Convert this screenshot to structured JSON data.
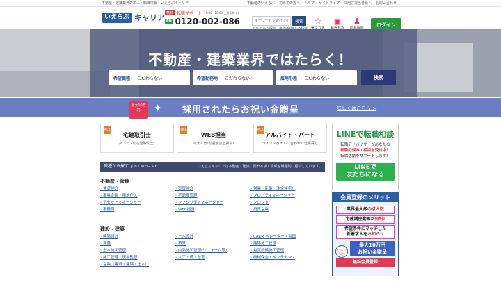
{
  "topbar": {
    "tagline": "不動産・建築業界の求人・転職情報｜いえらぶキャリア",
    "links": [
      "不動産のいえらぶ",
      "初めての方へ",
      "ヘルプ",
      "サイトマップ",
      "採用ご担当者様へ",
      "お問い合わせ"
    ]
  },
  "header": {
    "logo_box": "いえらぶ",
    "logo_text": "キャリア",
    "support_label": "転職サポート",
    "support_hours": "10:00〜18:00(土日祝除く)",
    "support_badge": "無料",
    "freedial": "FD",
    "tel": "0120-002-086",
    "search_placeholder": "キーワードや会社で検索",
    "search_btn": "検索",
    "link_area": "エリアから探す",
    "link_cond": "条件/特徴から探す",
    "fav": "気になる",
    "recent": "最近見た求人",
    "apply": "応募履歴",
    "login": "ログイン"
  },
  "hero": {
    "title": "不動産・建築業界ではたらく！",
    "sel1_key": "希望職種",
    "sel1_val": "こだわらない",
    "sel2_key": "希望勤務地",
    "sel2_val": "こだわらない",
    "sel3_key": "雇用形態",
    "sel3_val": "こだわらない",
    "search": "検索"
  },
  "banner": {
    "tag": "最大10万円",
    "text": "採用されたらお祝い金贈呈",
    "link": "詳しくはこちら >"
  },
  "cards": [
    {
      "pick": "PICK",
      "title": "宅建取引士",
      "desc": "高ニーズの宅建取引士!"
    },
    {
      "pick": "PICK",
      "title": "WEB担当",
      "desc": "今大人気!影響度急上昇中!"
    },
    {
      "pick": "PICK",
      "title": "アルバイト・パート",
      "desc": "ライフスタイルに合わせた仕事探し"
    }
  ],
  "jobs": {
    "head": "職種から探す",
    "head_en": "JOB CATEGORY",
    "note": "いえらぶキャリアは不動産・建築に関わる求人情報を職種別に紹介しています。",
    "cat1": "不動産・管理",
    "cat1_items": [
      "賃貸仲介",
      "売買仲介",
      "営業（新築・注文住宅）",
      "事業企画・用地仕入",
      "不動産管理",
      "プロパティマネージャー",
      "アセットマネージャー",
      "ファシリティマネージャー",
      "フロント",
      "事務職",
      "WEB担当",
      "投資営業"
    ],
    "cat2": "建設・建築",
    "cat2_items": [
      "建築設計",
      "土木設計",
      "CADオペレーター・製図",
      "測量",
      "積算",
      "建築施工管理",
      "土木施工管理",
      "内装施工管理(リフォーム等)",
      "電気設備施工管理",
      "施工管理・現場監督",
      "大工・鳶・左官",
      "機械保全・メンテナンス",
      "営業（建設・建築・土木）"
    ]
  },
  "line": {
    "title": "LINEで転職相談",
    "desc1": "転職アドバイザーがあなたの",
    "desc2": "転職の悩み・相談を受付中！",
    "desc3": "転職活動をサポートします！",
    "btn1": "LINEで",
    "btn2": "友だちになる"
  },
  "merit": {
    "title": "会員登録のメリット",
    "r1a": "業界最大級の",
    "r1b": "求人数",
    "r2a": "宅建講座動画が",
    "r2b": "無料!",
    "r3a": "希望条件にマッチした",
    "r3b": "新着求人を",
    "r3c": "お知らせ",
    "badge": "さらにさらに!",
    "money1": "最大10万円",
    "money2": "お祝い金贈呈",
    "reg": "無料会員登録"
  }
}
